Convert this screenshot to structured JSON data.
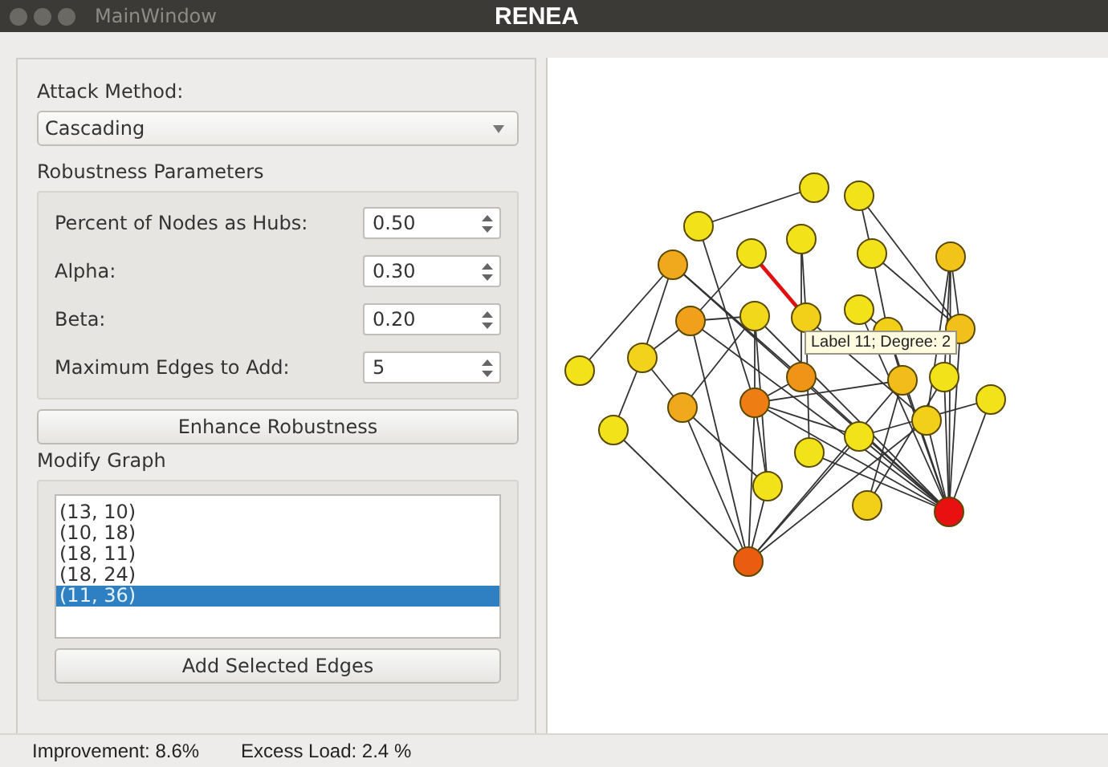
{
  "window": {
    "title": "MainWindow",
    "app_title": "RENEA"
  },
  "attack_method": {
    "label": "Attack Method:",
    "value": "Cascading"
  },
  "robustness_parameters": {
    "title": "Robustness Parameters",
    "fields": [
      {
        "label": "Percent of Nodes as Hubs:",
        "value": "0.50"
      },
      {
        "label": "Alpha:",
        "value": "0.30"
      },
      {
        "label": "Beta:",
        "value": "0.20"
      },
      {
        "label": "Maximum Edges to Add:",
        "value": "5"
      }
    ]
  },
  "enhance_button": "Enhance Robustness",
  "modify_graph": {
    "title": "Modify Graph",
    "edges": [
      {
        "label": "(13, 10)",
        "selected": false
      },
      {
        "label": "(10, 18)",
        "selected": false
      },
      {
        "label": "(18, 11)",
        "selected": false
      },
      {
        "label": "(18, 24)",
        "selected": false
      },
      {
        "label": "(11, 36)",
        "selected": true
      }
    ],
    "button": "Add Selected Edges"
  },
  "graph": {
    "nodes": [
      {
        "color": "#f2e21a"
      },
      {
        "color": "#f2e21a"
      },
      {
        "color": "#f2e21a"
      },
      {
        "color": "#f2e21a"
      },
      {
        "color": "#f2e21a"
      },
      {
        "color": "#f2e21a"
      },
      {
        "color": "#f2c41a"
      },
      {
        "color": "#f0a81c"
      },
      {
        "color": "#f2e21a"
      },
      {
        "color": "#f0a01a"
      },
      {
        "color": "#f2d81a"
      },
      {
        "color": "#f2d01a"
      },
      {
        "color": "#f2c01a"
      },
      {
        "color": "#f2d01a"
      },
      {
        "color": "#f2e21a"
      },
      {
        "color": "#f2d21a"
      },
      {
        "color": "#f09418"
      },
      {
        "color": "#f2bc1a"
      },
      {
        "color": "#f2e21a"
      },
      {
        "color": "#f0a81c"
      },
      {
        "color": "#ee7e14"
      },
      {
        "color": "#f2e21a"
      },
      {
        "color": "#f2d01a"
      },
      {
        "color": "#f2e21a"
      },
      {
        "color": "#f2e21a"
      },
      {
        "color": "#f2e21a"
      },
      {
        "color": "#f2e21a"
      },
      {
        "color": "#f2d01a"
      },
      {
        "color": "#e81010"
      },
      {
        "color": "#ea5c10"
      }
    ],
    "tooltip": "Label 11; Degree: 2"
  },
  "status_bar": [
    "Improvement: 8.6%",
    "Excess Load: 2.4 %"
  ]
}
